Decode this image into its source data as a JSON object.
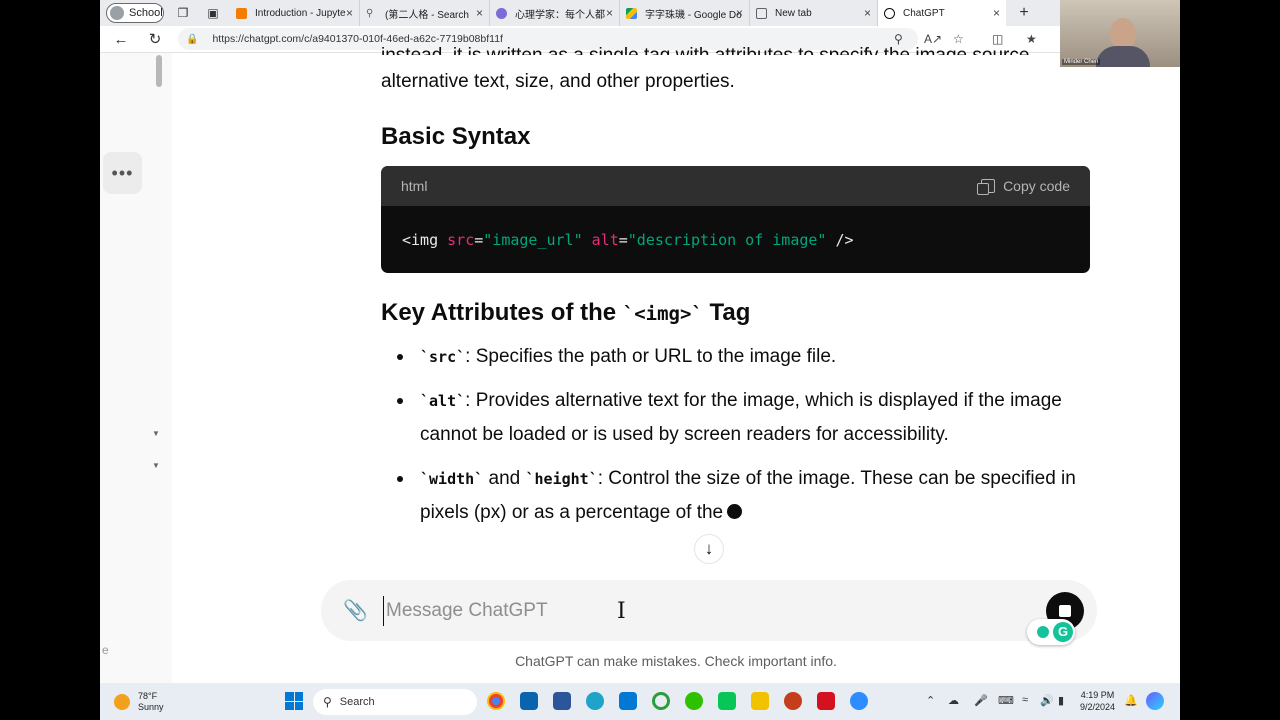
{
  "browser": {
    "profile_label": "School",
    "tabs": [
      {
        "title": "Introduction - Jupyte",
        "color": "#f57c00"
      },
      {
        "title": "(第二人格 - Search",
        "color": "#5f6368"
      },
      {
        "title": "心理学家：每个人都",
        "color": "#7b6cd9"
      },
      {
        "title": "字字珠璣 - Google Do",
        "color": "#fbbc04"
      },
      {
        "title": "New tab",
        "color": "#5f6368"
      },
      {
        "title": "ChatGPT",
        "color": "#0d0d0d"
      }
    ],
    "url": "https://chatgpt.com/c/a9401370-010f-46ed-a62c-7719b08bf11f"
  },
  "webcam": {
    "name": "Minder Chen"
  },
  "content": {
    "cut_line": "instead, it is written as a single tag with attributes to specify the image source,",
    "paragraph": "alternative text, size, and other properties.",
    "h_basic": "Basic Syntax",
    "code": {
      "lang": "html",
      "copy_label": "Copy code",
      "open": "<img",
      "attr1": "src",
      "eq1": "=",
      "val1": "\"image_url\"",
      "attr2": "alt",
      "eq2": "=",
      "val2": "\"description of image\"",
      "close": "/>"
    },
    "h_key_pre": "Key Attributes of the ",
    "h_key_code": "`<img>`",
    "h_key_post": " Tag",
    "items": [
      {
        "code": "`src`",
        "text": ": Specifies the path or URL to the image file."
      },
      {
        "code": "`alt`",
        "text": ": Provides alternative text for the image, which is displayed if the image cannot be loaded or is used by screen readers for accessibility."
      },
      {
        "code": "`width`",
        "mid": " and ",
        "code2": "`height`",
        "text": ": Control the size of the image. These can be specified in pixels (px) or as a percentage of the"
      }
    ]
  },
  "composer": {
    "placeholder": "Message ChatGPT",
    "disclaimer": "ChatGPT can make mistakes. Check important info."
  },
  "taskbar": {
    "temp": "78°F",
    "condition": "Sunny",
    "search_label": "Search",
    "time": "4:19 PM",
    "date": "9/2/2024"
  }
}
